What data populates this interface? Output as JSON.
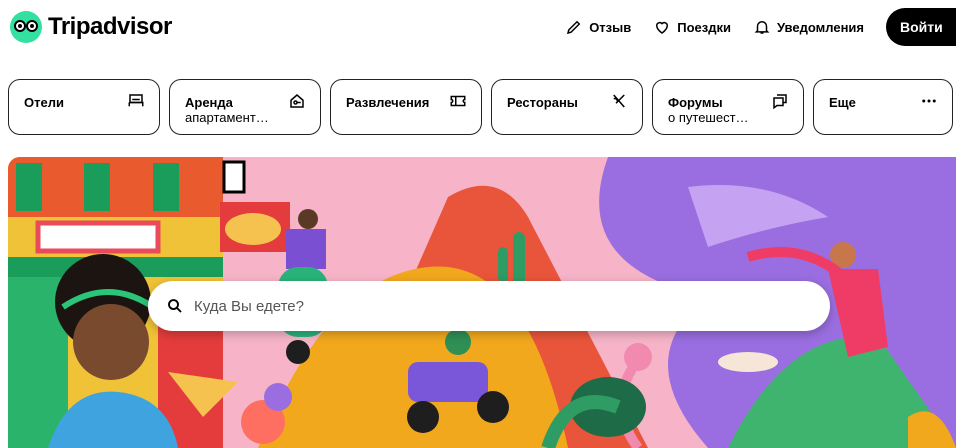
{
  "brand": {
    "name": "Tripadvisor"
  },
  "nav": {
    "review": "Отзыв",
    "trips": "Поездки",
    "alerts": "Уведомления",
    "login": "Войти"
  },
  "categories": [
    {
      "label": "Отели",
      "sub": "",
      "icon": "bed-icon"
    },
    {
      "label": "Аренда",
      "sub": "апартамент…",
      "icon": "house-key-icon"
    },
    {
      "label": "Развлечения",
      "sub": "",
      "icon": "ticket-icon"
    },
    {
      "label": "Рестораны",
      "sub": "",
      "icon": "utensils-icon"
    },
    {
      "label": "Форумы",
      "sub": "о путешест…",
      "icon": "chat-bubbles-icon"
    },
    {
      "label": "Еще",
      "sub": "",
      "icon": "more-dots-icon"
    }
  ],
  "search": {
    "placeholder": "Куда Вы едете?"
  },
  "colors": {
    "accent": "#34e0a1",
    "black": "#000000"
  }
}
